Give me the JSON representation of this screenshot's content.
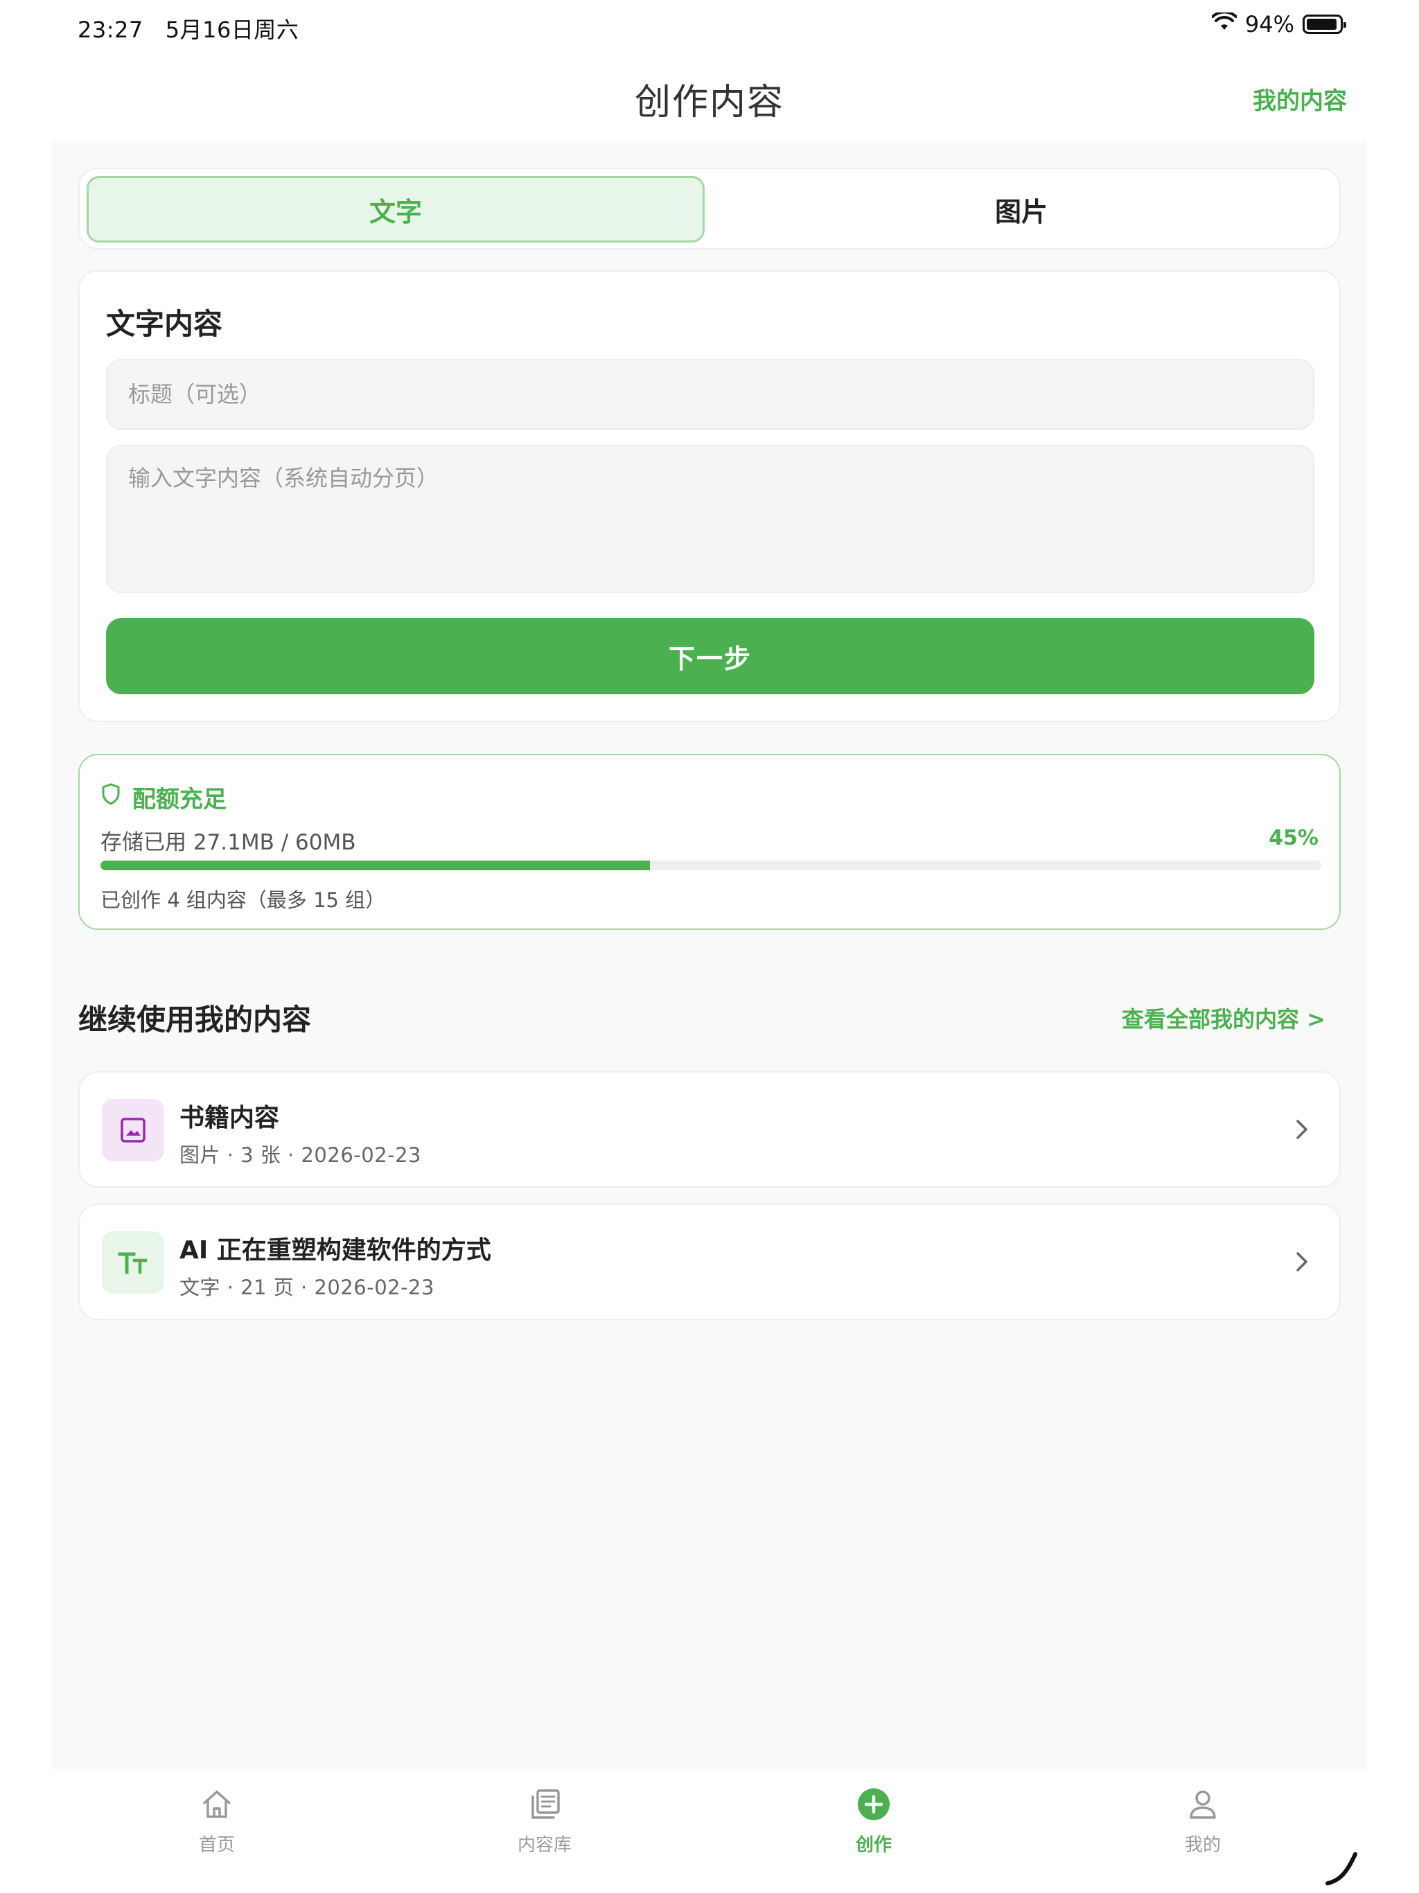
{
  "status_bar": {
    "time": "23:27",
    "date": "5月16日周六",
    "battery_pct_text": "94%",
    "battery_level": 0.94,
    "wifi_icon": "wifi-icon",
    "battery_icon": "battery-icon"
  },
  "nav": {
    "title": "创作内容",
    "my_content_link": "我的内容"
  },
  "segments": [
    {
      "label": "文字",
      "active": true
    },
    {
      "label": "图片",
      "active": false
    }
  ],
  "text_form": {
    "section_title": "文字内容",
    "title_placeholder": "标题（可选）",
    "body_placeholder": "输入文字内容（系统自动分页）",
    "next_button": "下一步"
  },
  "quota": {
    "status": "配额充足",
    "status_icon": "shield-icon",
    "storage_text": "存储已用 27.1MB / 60MB",
    "percent_text": "45%",
    "percent": 45,
    "created_text": "已创作 4 组内容（最多 15 组）"
  },
  "continue_section": {
    "title": "继续使用我的内容",
    "view_all": "查看全部我的内容 >",
    "items": [
      {
        "title": "书籍内容",
        "meta": "图片 · 3 张 · 2026-02-23",
        "icon": "image-icon"
      },
      {
        "title": "AI 正在重塑构建软件的方式",
        "meta": "文字 · 21 页 · 2026-02-23",
        "icon": "text-icon"
      }
    ]
  },
  "tab_bar": {
    "tabs": [
      {
        "label": "首页",
        "icon": "home-icon",
        "active": false
      },
      {
        "label": "内容库",
        "icon": "library-icon",
        "active": false
      },
      {
        "label": "创作",
        "icon": "plus-circle-icon",
        "active": true
      },
      {
        "label": "我的",
        "icon": "person-icon",
        "active": false
      }
    ]
  },
  "colors": {
    "accent": "#4caf50",
    "accent_light": "#e8f5e9",
    "accent_border": "#a5d6a7",
    "image_icon_bg": "#f3e5f5",
    "image_icon": "#9c27b0"
  }
}
